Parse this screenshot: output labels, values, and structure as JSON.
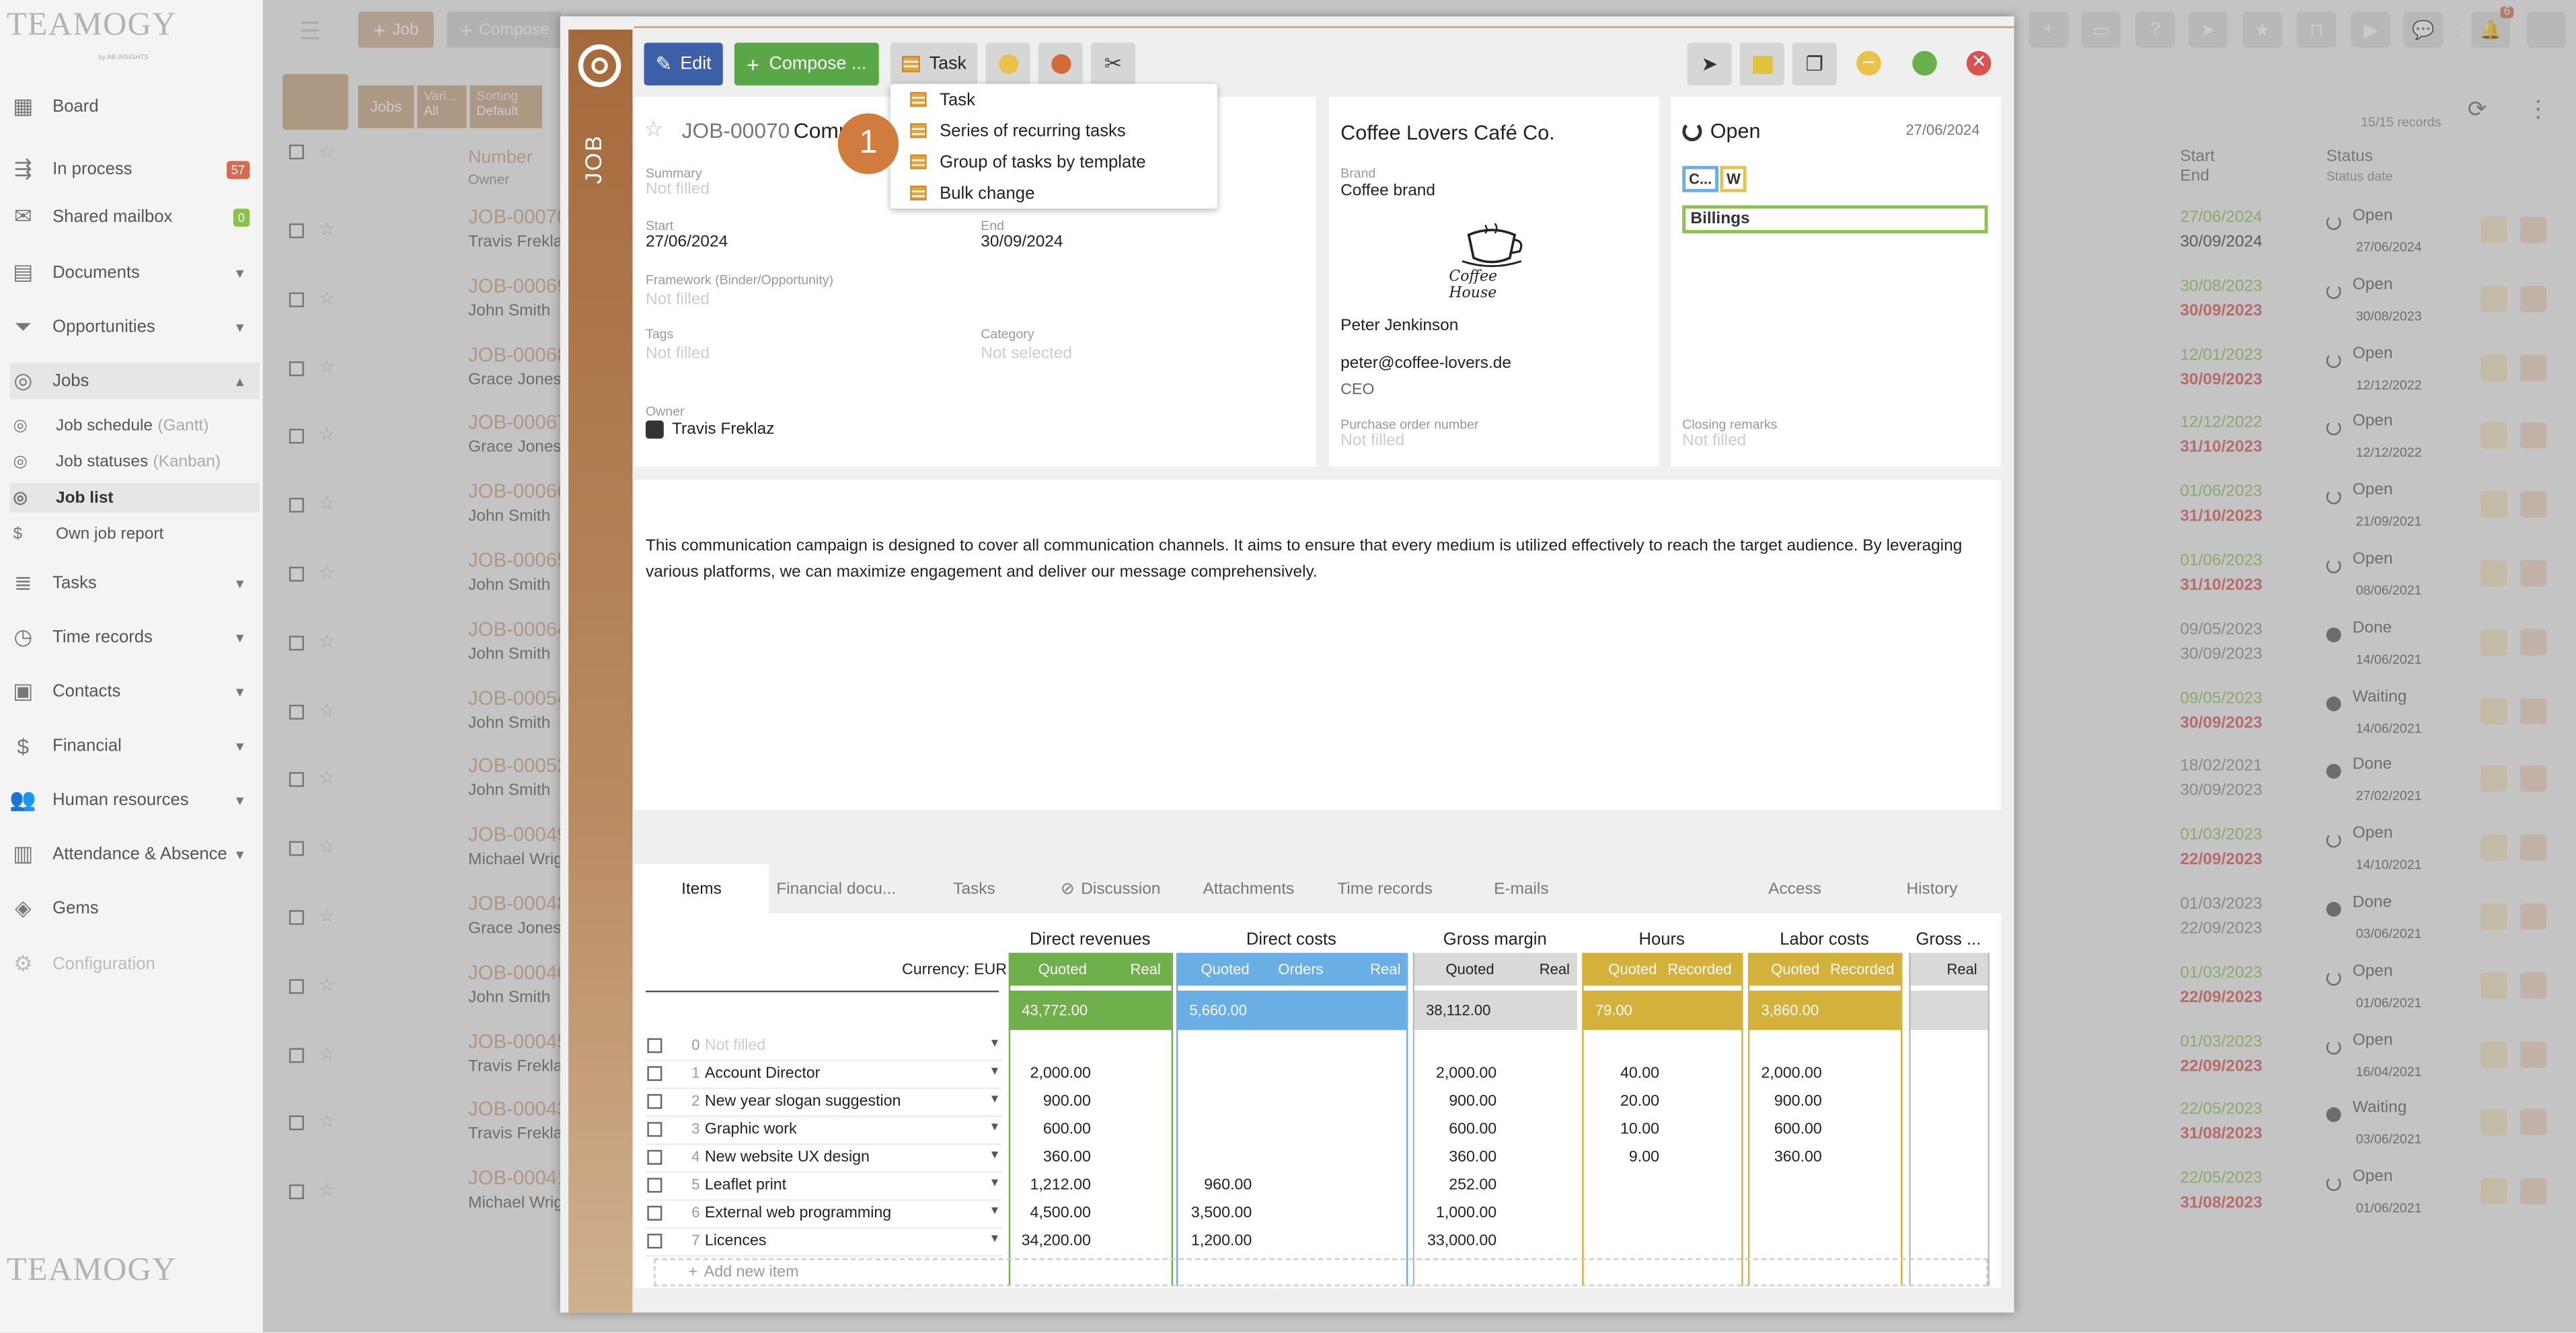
{
  "app": {
    "logo_text": "TEAMOGY",
    "logo_sub": "by AB INSIGHTS"
  },
  "sidebar": {
    "items": [
      {
        "label": "Board",
        "icon": "grid-icon"
      },
      {
        "label": "In process",
        "icon": "flow-icon",
        "badge": "57"
      },
      {
        "label": "Shared mailbox",
        "icon": "mail-icon",
        "badge": "0"
      },
      {
        "label": "Documents",
        "icon": "document-icon"
      },
      {
        "label": "Opportunities",
        "icon": "funnel-icon"
      },
      {
        "label": "Jobs",
        "icon": "target-icon"
      },
      {
        "label": "Tasks",
        "icon": "tasks-icon"
      },
      {
        "label": "Time records",
        "icon": "clock-icon"
      },
      {
        "label": "Contacts",
        "icon": "contact-icon"
      },
      {
        "label": "Financial",
        "icon": "dollar-icon"
      },
      {
        "label": "Human resources",
        "icon": "people-icon"
      },
      {
        "label": "Attendance & Absence",
        "icon": "building-icon"
      },
      {
        "label": "Gems",
        "icon": "gem-icon"
      },
      {
        "label": "Configuration",
        "icon": "gear-icon"
      }
    ],
    "jobs_sub": [
      {
        "label": "Job schedule",
        "suffix": "(Gantt)"
      },
      {
        "label": "Job statuses",
        "suffix": "(Kanban)"
      },
      {
        "label": "Job list",
        "suffix": ""
      },
      {
        "label": "Own job report",
        "suffix": ""
      }
    ]
  },
  "topbar": {
    "job_label": "Job",
    "compose_label": "Compose",
    "notif_count": "6"
  },
  "list": {
    "filter_jobs": "Jobs",
    "filter_vari": "Vari...",
    "filter_all": "All",
    "filter_sorting": "Sorting",
    "filter_default": "Default",
    "records": "15/15 records",
    "col_number": "Number",
    "col_owner": "Owner",
    "col_start": "Start",
    "col_end": "End",
    "col_status": "Status",
    "col_status_date": "Status date",
    "rows": [
      {
        "no": "JOB-00070",
        "owner": "Travis Freklaz",
        "start": "27/06/2024",
        "end": "30/09/2024",
        "status": "Open",
        "sdate": "27/06/2024",
        "start_c": "#8bc34a",
        "end_c": "#333"
      },
      {
        "no": "JOB-00069",
        "owner": "John Smith",
        "start": "30/08/2023",
        "end": "30/09/2023",
        "status": "Open",
        "sdate": "30/08/2023",
        "start_c": "#8bc34a",
        "end_c": "#d9534f"
      },
      {
        "no": "JOB-00068",
        "owner": "Grace Jones",
        "start": "12/01/2023",
        "end": "30/09/2023",
        "status": "Open",
        "sdate": "12/12/2022",
        "start_c": "#8bc34a",
        "end_c": "#d9534f"
      },
      {
        "no": "JOB-00067",
        "owner": "Grace Jones",
        "start": "12/12/2022",
        "end": "31/10/2023",
        "status": "Open",
        "sdate": "12/12/2022",
        "start_c": "#8bc34a",
        "end_c": "#d9534f"
      },
      {
        "no": "JOB-00066",
        "owner": "John Smith",
        "start": "01/06/2023",
        "end": "31/10/2023",
        "status": "Open",
        "sdate": "21/09/2021",
        "start_c": "#8bc34a",
        "end_c": "#d9534f"
      },
      {
        "no": "JOB-00065",
        "owner": "John Smith",
        "start": "01/06/2023",
        "end": "31/10/2023",
        "status": "Open",
        "sdate": "08/06/2021",
        "start_c": "#8bc34a",
        "end_c": "#d9534f"
      },
      {
        "no": "JOB-00064",
        "owner": "John Smith",
        "start": "09/05/2023",
        "end": "30/09/2023",
        "status": "Done",
        "sdate": "14/06/2021",
        "start_c": "#888",
        "end_c": "#888"
      },
      {
        "no": "JOB-00054",
        "owner": "John Smith",
        "start": "09/05/2023",
        "end": "30/09/2023",
        "status": "Waiting",
        "sdate": "14/06/2021",
        "start_c": "#8bc34a",
        "end_c": "#d9534f"
      },
      {
        "no": "JOB-00052",
        "owner": "John Smith",
        "start": "18/02/2021",
        "end": "30/09/2023",
        "status": "Done",
        "sdate": "27/02/2021",
        "start_c": "#888",
        "end_c": "#888"
      },
      {
        "no": "JOB-00049",
        "owner": "Michael Wright",
        "start": "01/03/2023",
        "end": "22/09/2023",
        "status": "Open",
        "sdate": "14/10/2021",
        "start_c": "#8bc34a",
        "end_c": "#d9534f"
      },
      {
        "no": "JOB-00048",
        "owner": "Grace Jones",
        "start": "01/03/2023",
        "end": "22/09/2023",
        "status": "Done",
        "sdate": "03/06/2021",
        "start_c": "#888",
        "end_c": "#888"
      },
      {
        "no": "JOB-00046",
        "owner": "John Smith",
        "start": "01/03/2023",
        "end": "22/09/2023",
        "status": "Open",
        "sdate": "01/06/2021",
        "start_c": "#8bc34a",
        "end_c": "#d9534f"
      },
      {
        "no": "JOB-00045",
        "owner": "Travis Freklaz",
        "start": "01/03/2023",
        "end": "22/09/2023",
        "status": "Open",
        "sdate": "16/04/2021",
        "start_c": "#8bc34a",
        "end_c": "#d9534f"
      },
      {
        "no": "JOB-00043",
        "owner": "Travis Freklaz",
        "start": "22/05/2023",
        "end": "31/08/2023",
        "status": "Waiting",
        "sdate": "03/06/2021",
        "start_c": "#8bc34a",
        "end_c": "#d9534f"
      },
      {
        "no": "JOB-00041",
        "owner": "Michael Wright",
        "start": "22/05/2023",
        "end": "31/08/2023",
        "status": "Open",
        "sdate": "01/06/2021",
        "start_c": "#8bc34a",
        "end_c": "#d9534f"
      }
    ]
  },
  "modal": {
    "side_label": "JOB",
    "edit_label": "Edit",
    "compose_label": "Compose ...",
    "task_label": "Task",
    "job_id": "JOB-00070",
    "job_title": "Comp",
    "summary_label": "Summary",
    "not_filled": "Not filled",
    "start_label": "Start",
    "start_value": "27/06/2024",
    "end_label": "End",
    "end_value": "30/09/2024",
    "framework_label": "Framework (Binder/Opportunity)",
    "tags_label": "Tags",
    "category_label": "Category",
    "not_selected": "Not selected",
    "owner_label": "Owner",
    "owner_value": "Travis Freklaz",
    "company": "Coffee Lovers Café Co.",
    "brand_label": "Brand",
    "brand_value": "Coffee brand",
    "brand_logo_text": "Coffee House",
    "contact_name": "Peter Jenkinson",
    "contact_email": "peter@coffee-lovers.de",
    "contact_role": "CEO",
    "po_label": "Purchase order number",
    "status": "Open",
    "status_date": "27/06/2024",
    "tag_c": "C...",
    "tag_w": "W",
    "billings": "Billings",
    "closing_label": "Closing remarks",
    "description": "This communication campaign is designed to cover all communication channels. It aims to ensure that every medium is utilized effectively to reach the target audience. By leveraging various platforms, we can maximize engagement and deliver our message comprehensively.",
    "step_marker": "1"
  },
  "dropdown": {
    "items": [
      "Task",
      "Series of recurring tasks",
      "Group of tasks by template",
      "Bulk change"
    ]
  },
  "tabs": [
    "Items",
    "Financial docu...",
    "Tasks",
    "Discussion",
    "Attachments",
    "Time records",
    "E-mails",
    "Access",
    "History"
  ],
  "items_table": {
    "currency": "Currency: EUR",
    "groups": [
      "Direct revenues",
      "Direct costs",
      "Gross margin",
      "Hours",
      "Labor costs",
      "Gross ..."
    ],
    "sub": {
      "quoted": "Quoted",
      "real": "Real",
      "orders": "Orders",
      "recorded": "Recorded"
    },
    "sums": {
      "rev": "43,772.00",
      "cost": "5,660.00",
      "margin": "38,112.00",
      "hours": "79.00",
      "labor": "3,860.00"
    },
    "add_new": "Add new item",
    "rows": [
      {
        "n": "0",
        "name": "Not filled",
        "rev": "",
        "cost": "",
        "margin": "",
        "hours": "",
        "labor": "",
        "placeholder": true
      },
      {
        "n": "1",
        "name": "Account Director",
        "rev": "2,000.00",
        "cost": "",
        "margin": "2,000.00",
        "hours": "40.00",
        "labor": "2,000.00"
      },
      {
        "n": "2",
        "name": "New year slogan suggestion",
        "rev": "900.00",
        "cost": "",
        "margin": "900.00",
        "hours": "20.00",
        "labor": "900.00"
      },
      {
        "n": "3",
        "name": "Graphic work",
        "rev": "600.00",
        "cost": "",
        "margin": "600.00",
        "hours": "10.00",
        "labor": "600.00"
      },
      {
        "n": "4",
        "name": "New website UX design",
        "rev": "360.00",
        "cost": "",
        "margin": "360.00",
        "hours": "9.00",
        "labor": "360.00"
      },
      {
        "n": "5",
        "name": "Leaflet print",
        "rev": "1,212.00",
        "cost": "960.00",
        "margin": "252.00",
        "hours": "",
        "labor": ""
      },
      {
        "n": "6",
        "name": "External web programming",
        "rev": "4,500.00",
        "cost": "3,500.00",
        "margin": "1,000.00",
        "hours": "",
        "labor": ""
      },
      {
        "n": "7",
        "name": "Licences",
        "rev": "34,200.00",
        "cost": "1,200.00",
        "margin": "33,000.00",
        "hours": "",
        "labor": ""
      }
    ]
  },
  "colors": {
    "revenue": "#6fb04a",
    "costs": "#6aaee6",
    "margin": "#d9d9d9",
    "hours": "#d4b13a",
    "brand": "#a56a3c"
  }
}
